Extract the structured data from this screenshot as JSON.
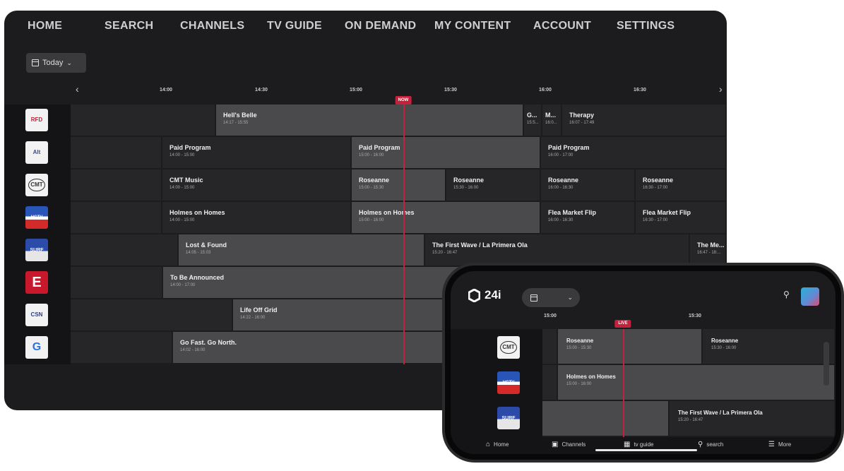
{
  "tv": {
    "nav": [
      "HOME",
      "SEARCH",
      "CHANNELS",
      "TV GUIDE",
      "ON DEMAND",
      "MY CONTENT",
      "ACCOUNT",
      "SETTINGS"
    ],
    "date_label": "Today",
    "timeline": {
      "ticks": [
        "14:00",
        "14:30",
        "15:00",
        "15:30",
        "16:00",
        "16:30"
      ],
      "now_label": "NOW",
      "prev_arrow": "‹",
      "next_arrow": "›"
    },
    "channels": [
      {
        "logo": "RFD"
      },
      {
        "logo": "Alt"
      },
      {
        "logo": "CMT"
      },
      {
        "logo": "HGTV"
      },
      {
        "logo": "SURF"
      },
      {
        "logo": "E"
      },
      {
        "logo": "CSN"
      },
      {
        "logo": "G"
      }
    ],
    "programs": [
      {
        "title": "Hell's Belle",
        "time": "14:17 - 15:55"
      },
      {
        "title": "G...",
        "time": "15:5..."
      },
      {
        "title": "M...",
        "time": "16:0..."
      },
      {
        "title": "Therapy",
        "time": "16:07 - 17:49"
      },
      {
        "title": "Paid Program",
        "time": "14:00 - 15:00"
      },
      {
        "title": "Paid Program",
        "time": "15:00 - 16:00"
      },
      {
        "title": "Paid Program",
        "time": "16:00 - 17:00"
      },
      {
        "title": "CMT Music",
        "time": "14:00 - 15:00"
      },
      {
        "title": "Roseanne",
        "time": "15:00 - 15:30"
      },
      {
        "title": "Roseanne",
        "time": "15:30 - 16:00"
      },
      {
        "title": "Roseanne",
        "time": "16:00 - 16:30"
      },
      {
        "title": "Roseanne",
        "time": "16:30 - 17:00"
      },
      {
        "title": "Holmes on Homes",
        "time": "14:00 - 15:00"
      },
      {
        "title": "Holmes on Homes",
        "time": "15:00 - 16:00"
      },
      {
        "title": "Flea Market Flip",
        "time": "16:00 - 16:30"
      },
      {
        "title": "Flea Market Flip",
        "time": "16:30 - 17:00"
      },
      {
        "title": "Lost & Found",
        "time": "14:05 - 15:03"
      },
      {
        "title": "The First Wave / La Primera Ola",
        "time": "15:20 - 16:47"
      },
      {
        "title": "The Me...",
        "time": "16:47 - 18:..."
      },
      {
        "title": "To Be Announced",
        "time": "14:00 - 17:00"
      },
      {
        "title": "Life Off Grid",
        "time": "14:22 - 16:00"
      },
      {
        "title": "Go Fast. Go North.",
        "time": "14:02 - 16:00"
      }
    ]
  },
  "phone": {
    "brand": "24i",
    "timeline": {
      "ticks": [
        "15:00",
        "15:30"
      ],
      "live_label": "LIVE"
    },
    "channels": [
      {
        "logo": "CMT"
      },
      {
        "logo": "HGTV"
      },
      {
        "logo": "SURF"
      }
    ],
    "programs": [
      {
        "title": "Roseanne",
        "time": "15:00 - 15:30"
      },
      {
        "title": "Roseanne",
        "time": "15:30 - 16:00"
      },
      {
        "title": "Holmes on Homes",
        "time": "15:00 - 16:00"
      },
      {
        "title": "The First Wave / La Primera Ola",
        "time": "15:20 - 16:47"
      }
    ],
    "tabs": [
      "Home",
      "Channels",
      "tv guide",
      "search",
      "More"
    ]
  },
  "colors": {
    "accent": "#c2223c",
    "background": "#1c1c1e",
    "cell_dark": "#262629",
    "cell_light": "#4a4a4d"
  }
}
